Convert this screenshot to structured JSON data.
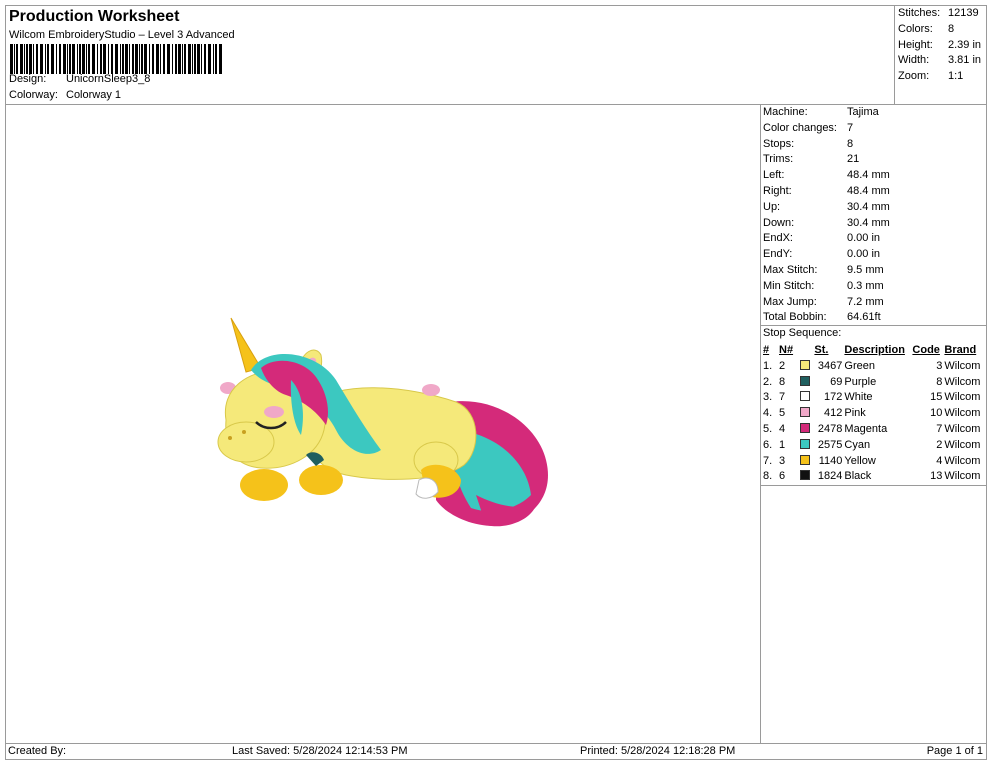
{
  "header": {
    "title": "Production Worksheet",
    "software": "Wilcom EmbroideryStudio – Level 3 Advanced",
    "design_label": "Design:",
    "design_value": "UnicornSleep3_8",
    "colorway_label": "Colorway:",
    "colorway_value": "Colorway 1"
  },
  "summary": {
    "stitches_label": "Stitches:",
    "stitches_value": "12139",
    "colors_label": "Colors:",
    "colors_value": "8",
    "height_label": "Height:",
    "height_value": "2.39 in",
    "width_label": "Width:",
    "width_value": "3.81 in",
    "zoom_label": "Zoom:",
    "zoom_value": "1:1"
  },
  "details": {
    "rows": [
      {
        "label": "Machine:",
        "value": "Tajima"
      },
      {
        "label": "Color changes:",
        "value": "7"
      },
      {
        "label": "Stops:",
        "value": "8"
      },
      {
        "label": "Trims:",
        "value": "21"
      },
      {
        "label": "Left:",
        "value": "48.4 mm"
      },
      {
        "label": "Right:",
        "value": "48.4 mm"
      },
      {
        "label": "Up:",
        "value": "30.4 mm"
      },
      {
        "label": "Down:",
        "value": "30.4 mm"
      },
      {
        "label": "EndX:",
        "value": "0.00 in"
      },
      {
        "label": "EndY:",
        "value": "0.00 in"
      },
      {
        "label": "Max Stitch:",
        "value": "9.5 mm"
      },
      {
        "label": "Min Stitch:",
        "value": "0.3 mm"
      },
      {
        "label": "Max Jump:",
        "value": "7.2 mm"
      },
      {
        "label": "Total Bobbin:",
        "value": "64.61ft"
      }
    ],
    "stop_sequence_title": "Stop Sequence:"
  },
  "stop_sequence": {
    "headers": {
      "num": "#",
      "n": "N#",
      "st": "St.",
      "desc": "Description",
      "code": "Code",
      "brand": "Brand"
    },
    "rows": [
      {
        "num": "1.",
        "n": "2",
        "color": "#f5e97a",
        "st": "3467",
        "desc": "Green",
        "code": "3",
        "brand": "Wilcom"
      },
      {
        "num": "2.",
        "n": "8",
        "color": "#1f5f5f",
        "st": "69",
        "desc": "Purple",
        "code": "8",
        "brand": "Wilcom"
      },
      {
        "num": "3.",
        "n": "7",
        "color": "#ffffff",
        "st": "172",
        "desc": "White",
        "code": "15",
        "brand": "Wilcom"
      },
      {
        "num": "4.",
        "n": "5",
        "color": "#f0a8c8",
        "st": "412",
        "desc": "Pink",
        "code": "10",
        "brand": "Wilcom"
      },
      {
        "num": "5.",
        "n": "4",
        "color": "#d42a7a",
        "st": "2478",
        "desc": "Magenta",
        "code": "7",
        "brand": "Wilcom"
      },
      {
        "num": "6.",
        "n": "1",
        "color": "#3cc8c0",
        "st": "2575",
        "desc": "Cyan",
        "code": "2",
        "brand": "Wilcom"
      },
      {
        "num": "7.",
        "n": "3",
        "color": "#f5c21a",
        "st": "1140",
        "desc": "Yellow",
        "code": "4",
        "brand": "Wilcom"
      },
      {
        "num": "8.",
        "n": "6",
        "color": "#111111",
        "st": "1824",
        "desc": "Black",
        "code": "13",
        "brand": "Wilcom"
      }
    ]
  },
  "footer": {
    "created_by": "Created By:",
    "last_saved": "Last Saved: 5/28/2024 12:14:53 PM",
    "printed": "Printed: 5/28/2024 12:18:28 PM",
    "page": "Page 1 of 1"
  }
}
